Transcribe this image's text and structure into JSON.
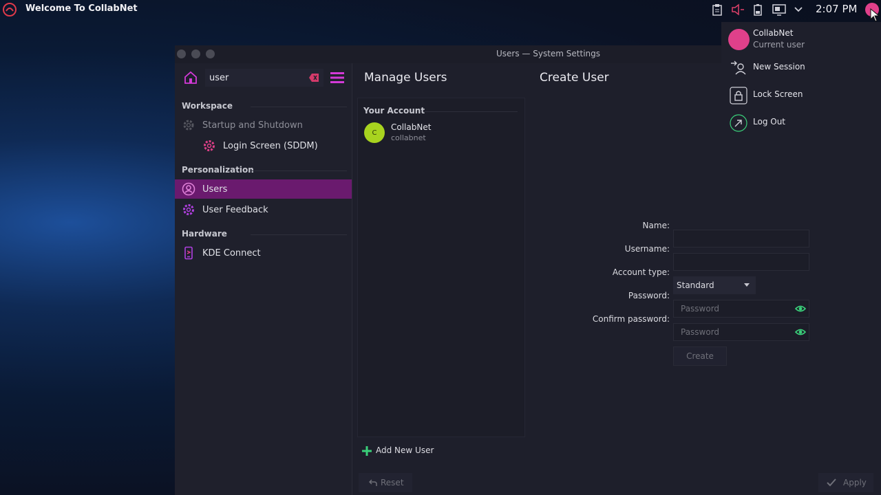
{
  "topbar": {
    "app_title": "Welcome To CollabNet",
    "clock": "2:07 PM",
    "tray_icons": [
      "clipboard-icon",
      "volume-icon",
      "battery-icon",
      "display-icon",
      "chevron-down-icon"
    ]
  },
  "window": {
    "title": "Users — System Settings"
  },
  "sidebar": {
    "search_value": "user",
    "sections": [
      {
        "label": "Workspace"
      },
      {
        "label": "Personalization"
      },
      {
        "label": "Hardware"
      }
    ],
    "items": [
      {
        "label": "Startup and Shutdown",
        "icon": "gear-icon",
        "dimmed": true
      },
      {
        "label": "Login Screen (SDDM)",
        "icon": "gear-icon"
      },
      {
        "label": "Users",
        "icon": "user-icon",
        "active": true
      },
      {
        "label": "User Feedback",
        "icon": "gear-icon"
      },
      {
        "label": "KDE Connect",
        "icon": "phone-icon"
      }
    ]
  },
  "main": {
    "manage_title": "Manage Users",
    "create_title": "Create User",
    "your_account_label": "Your Account",
    "account": {
      "initial": "C",
      "name": "CollabNet",
      "login": "collabnet"
    },
    "add_user_label": "Add New User",
    "form": {
      "name_label": "Name:",
      "username_label": "Username:",
      "account_type_label": "Account type:",
      "account_type_value": "Standard",
      "password_label": "Password:",
      "password_placeholder": "Password",
      "confirm_label": "Confirm password:",
      "confirm_placeholder": "Password",
      "create_label": "Create"
    },
    "reset_label": "Reset",
    "apply_label": "Apply"
  },
  "user_menu": {
    "name": "CollabNet",
    "subtitle": "Current user",
    "items": [
      {
        "label": "New Session",
        "icon": "new-session-icon"
      },
      {
        "label": "Lock Screen",
        "icon": "lock-icon"
      },
      {
        "label": "Log Out",
        "icon": "logout-icon"
      }
    ]
  },
  "colors": {
    "accent": "#e040c8",
    "active_item": "#6a1a6e",
    "avatar_user": "#a8d31f",
    "avatar_tray": "#e0408a",
    "eye": "#3ad07a"
  }
}
